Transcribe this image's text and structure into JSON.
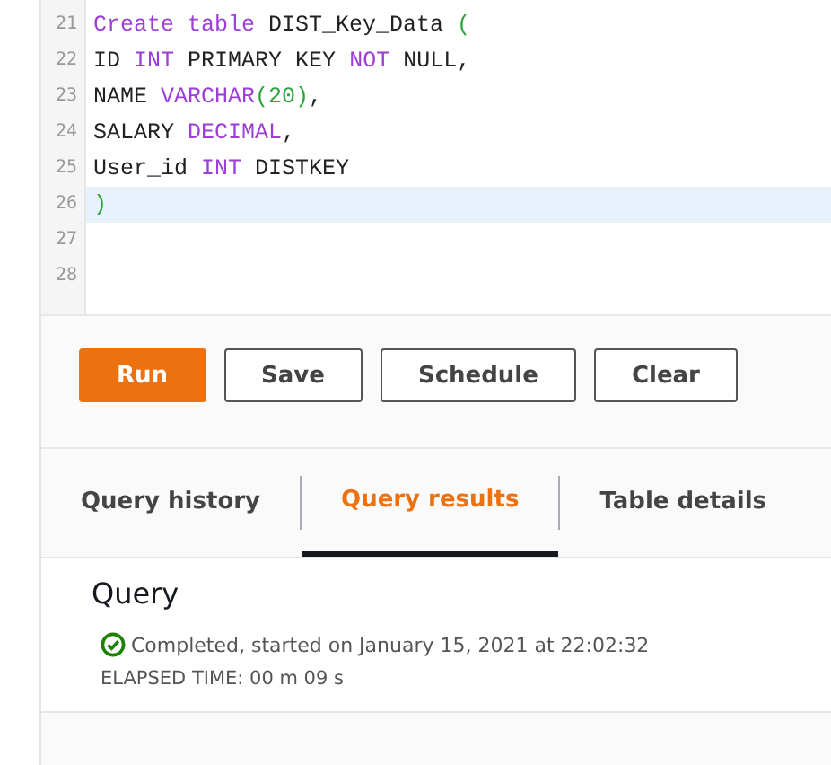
{
  "editor": {
    "lines": [
      {
        "number": "21",
        "active": false,
        "tokens": [
          {
            "kind": "keyword",
            "text": "Create table"
          },
          {
            "kind": "plain",
            "text": " DIST_Key_Data "
          },
          {
            "kind": "punct",
            "text": "("
          }
        ]
      },
      {
        "number": "22",
        "active": false,
        "tokens": [
          {
            "kind": "plain",
            "text": "ID "
          },
          {
            "kind": "keyword",
            "text": "INT"
          },
          {
            "kind": "plain",
            "text": " PRIMARY KEY "
          },
          {
            "kind": "keyword",
            "text": "NOT"
          },
          {
            "kind": "plain",
            "text": " NULL,"
          }
        ]
      },
      {
        "number": "23",
        "active": false,
        "tokens": [
          {
            "kind": "plain",
            "text": "NAME "
          },
          {
            "kind": "keyword",
            "text": "VARCHAR"
          },
          {
            "kind": "punct",
            "text": "(20)"
          },
          {
            "kind": "plain",
            "text": ","
          }
        ]
      },
      {
        "number": "24",
        "active": false,
        "tokens": [
          {
            "kind": "plain",
            "text": "SALARY "
          },
          {
            "kind": "keyword",
            "text": "DECIMAL"
          },
          {
            "kind": "plain",
            "text": ","
          }
        ]
      },
      {
        "number": "25",
        "active": false,
        "tokens": [
          {
            "kind": "plain",
            "text": "User_id "
          },
          {
            "kind": "keyword",
            "text": "INT"
          },
          {
            "kind": "plain",
            "text": " DISTKEY"
          }
        ]
      },
      {
        "number": "26",
        "active": true,
        "tokens": [
          {
            "kind": "punct",
            "text": ")"
          }
        ]
      },
      {
        "number": "27",
        "active": false
      },
      {
        "number": "28",
        "active": false
      }
    ]
  },
  "buttons": [
    {
      "label": "Run",
      "kind": "primary"
    },
    {
      "label": "Save",
      "kind": "normal"
    },
    {
      "label": "Schedule",
      "kind": "normal"
    },
    {
      "label": "Clear",
      "kind": "normal"
    }
  ],
  "tabs": [
    {
      "label": "Query history",
      "selected": false
    },
    {
      "label": "Query results",
      "selected": true
    },
    {
      "label": "Table details",
      "selected": false
    }
  ],
  "results": {
    "title": "Query",
    "status": "Completed, started on January 15, 2021 at 22:02:32",
    "elapsed": "ELAPSED TIME: 00 m 09 s"
  }
}
